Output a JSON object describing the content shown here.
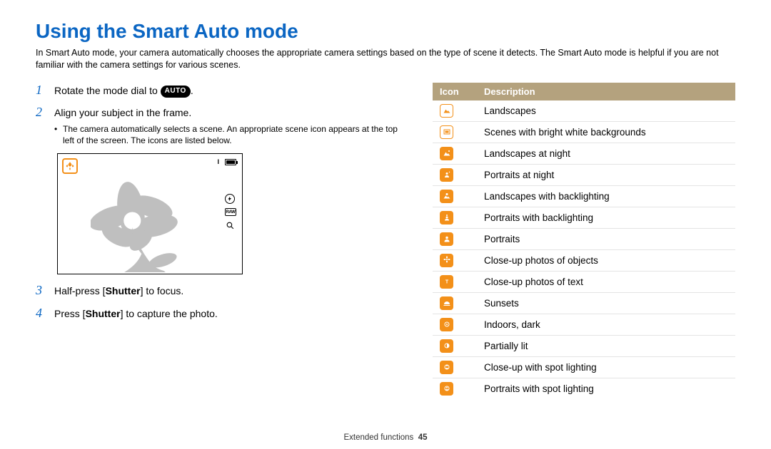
{
  "title": "Using the Smart Auto mode",
  "intro": "In Smart Auto mode, your camera automatically chooses the appropriate camera settings based on the type of scene it detects. The Smart Auto mode is helpful if you are not familiar with the camera settings for various scenes.",
  "steps": {
    "s1": {
      "num": "1",
      "pre": "Rotate the mode dial to ",
      "badge": "AUTO",
      "post": "."
    },
    "s2": {
      "num": "2",
      "text": "Align your subject in the frame.",
      "note": "The camera automatically selects a scene. An appropriate scene icon appears at the top left of the screen. The icons are listed below."
    },
    "s3": {
      "num": "3",
      "pre": "Half-press [",
      "bold": "Shutter",
      "post": "] to focus."
    },
    "s4": {
      "num": "4",
      "pre": "Press [",
      "bold": "Shutter",
      "post": "] to capture the photo."
    }
  },
  "tableHeaders": {
    "icon": "Icon",
    "desc": "Description"
  },
  "scenes": [
    {
      "desc": "Landscapes"
    },
    {
      "desc": "Scenes with bright white backgrounds"
    },
    {
      "desc": "Landscapes at night"
    },
    {
      "desc": "Portraits at night"
    },
    {
      "desc": "Landscapes with backlighting"
    },
    {
      "desc": "Portraits with backlighting"
    },
    {
      "desc": "Portraits"
    },
    {
      "desc": "Close-up photos of objects"
    },
    {
      "desc": "Close-up photos of text"
    },
    {
      "desc": "Sunsets"
    },
    {
      "desc": "Indoors, dark"
    },
    {
      "desc": "Partially lit"
    },
    {
      "desc": "Close-up with spot lighting"
    },
    {
      "desc": "Portraits with spot lighting"
    }
  ],
  "footer": {
    "section": "Extended functions",
    "page": "45"
  }
}
